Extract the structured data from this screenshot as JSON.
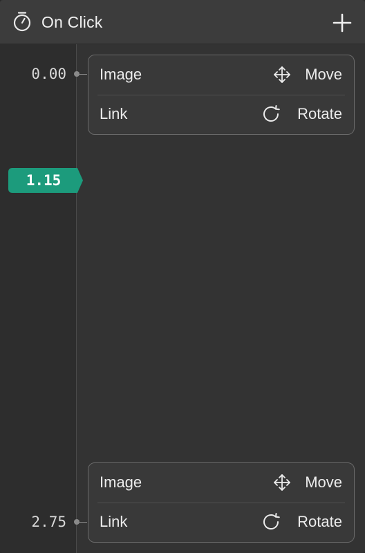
{
  "header": {
    "title": "On Click",
    "icon": "timer-icon",
    "add_icon": "plus-icon"
  },
  "playhead": {
    "value": "1.15",
    "color": "#1c9b7c"
  },
  "keyframes": [
    {
      "time": "0.00",
      "actions": [
        {
          "target": "Image",
          "action": "Move",
          "icon": "move-icon"
        },
        {
          "target": "Link",
          "action": "Rotate",
          "icon": "rotate-icon"
        }
      ]
    },
    {
      "time": "2.75",
      "actions": [
        {
          "target": "Image",
          "action": "Move",
          "icon": "move-icon"
        },
        {
          "target": "Link",
          "action": "Rotate",
          "icon": "rotate-icon"
        }
      ]
    }
  ]
}
